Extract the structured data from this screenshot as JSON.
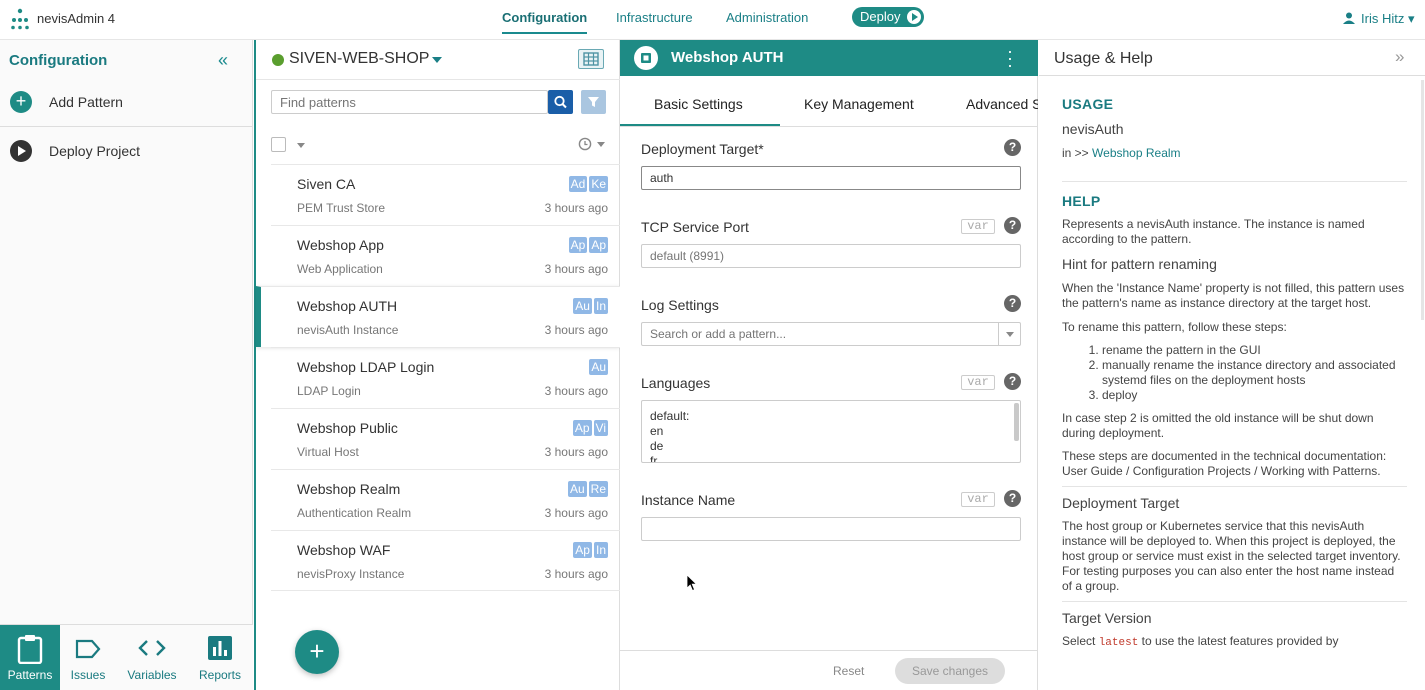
{
  "app": {
    "title": "nevisAdmin 4"
  },
  "topnav": {
    "items": [
      "Configuration",
      "Infrastructure",
      "Administration"
    ],
    "deploy_label": "Deploy"
  },
  "user": {
    "name": "Iris Hitz"
  },
  "sidebar": {
    "title": "Configuration",
    "actions": [
      {
        "label": "Add Pattern",
        "icon": "plus-circle-icon"
      },
      {
        "label": "Deploy Project",
        "icon": "play-circle-icon"
      }
    ],
    "bottom_tabs": [
      {
        "label": "Patterns",
        "icon": "clipboard-icon",
        "active": true
      },
      {
        "label": "Issues",
        "icon": "tag-icon",
        "active": false
      },
      {
        "label": "Variables",
        "icon": "code-icon",
        "active": false
      },
      {
        "label": "Reports",
        "icon": "bar-chart-icon",
        "active": false
      }
    ]
  },
  "project": {
    "name": "SIVEN-WEB-SHOP",
    "search_placeholder": "Find patterns",
    "patterns": [
      {
        "name": "Siven CA",
        "type": "PEM Trust Store",
        "time": "3 hours ago",
        "badges": [
          "Ad",
          "Ke"
        ]
      },
      {
        "name": "Webshop App",
        "type": "Web Application",
        "time": "3 hours ago",
        "badges": [
          "Ap",
          "Ap"
        ]
      },
      {
        "name": "Webshop AUTH",
        "type": "nevisAuth Instance",
        "time": "3 hours ago",
        "badges": [
          "Au",
          "In"
        ]
      },
      {
        "name": "Webshop LDAP Login",
        "type": "LDAP Login",
        "time": "3 hours ago",
        "badges": [
          "Au"
        ]
      },
      {
        "name": "Webshop Public",
        "type": "Virtual Host",
        "time": "3 hours ago",
        "badges": [
          "Ap",
          "Vi"
        ]
      },
      {
        "name": "Webshop Realm",
        "type": "Authentication Realm",
        "time": "3 hours ago",
        "badges": [
          "Au",
          "Re"
        ]
      },
      {
        "name": "Webshop WAF",
        "type": "nevisProxy Instance",
        "time": "3 hours ago",
        "badges": [
          "Ap",
          "In"
        ]
      }
    ]
  },
  "editor": {
    "title": "Webshop AUTH",
    "tabs": [
      "Basic Settings",
      "Key Management",
      "Advanced Settings"
    ],
    "fields": {
      "deployment_target": {
        "label": "Deployment Target*",
        "value": "auth"
      },
      "tcp_port": {
        "label": "TCP Service Port",
        "placeholder": "default (8991)"
      },
      "log_settings": {
        "label": "Log Settings",
        "placeholder": "Search or add a pattern..."
      },
      "languages": {
        "label": "Languages",
        "lines": [
          "default:",
          "en",
          "de",
          "fr"
        ]
      },
      "instance_name": {
        "label": "Instance Name",
        "value": ""
      }
    },
    "var_label": "var",
    "reset_label": "Reset",
    "save_label": "Save changes"
  },
  "help": {
    "title": "Usage & Help",
    "usage_title": "USAGE",
    "usage_name": "nevisAuth",
    "usage_in_prefix": "in >>",
    "usage_in_link": "Webshop Realm",
    "help_title": "HELP",
    "intro": "Represents a nevisAuth instance. The instance is named according to the pattern.",
    "hint_title": "Hint for pattern renaming",
    "hint_text": "When the 'Instance Name' property is not filled, this pattern uses the pattern's name as instance directory at the target host.",
    "rename_intro": "To rename this pattern, follow these steps:",
    "steps": [
      "rename the pattern in the GUI",
      "manually rename the instance directory and associated systemd files on the deployment hosts",
      "deploy"
    ],
    "step2_note": "In case step 2 is omitted the old instance will be shut down during deployment.",
    "docs_note": "These steps are documented in the technical documentation: User Guide / Configuration Projects / Working with Patterns.",
    "dt_title": "Deployment Target",
    "dt_text": "The host group or Kubernetes service that this nevisAuth instance will be deployed to. When this project is deployed, the host group or service must exist in the selected target inventory. For testing purposes you can also enter the host name instead of a group.",
    "tv_title": "Target Version",
    "tv_prefix": "Select",
    "tv_code": "latest",
    "tv_suffix": "to use the latest features provided by"
  }
}
